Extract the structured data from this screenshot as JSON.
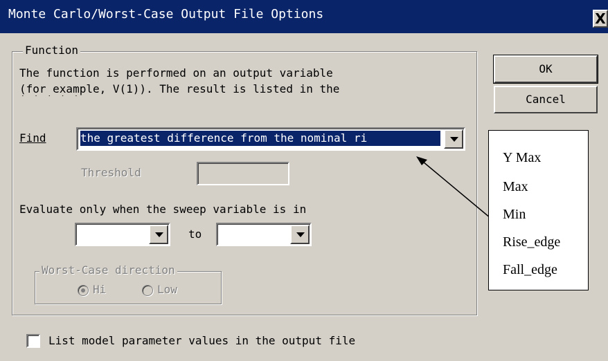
{
  "window": {
    "title": "Monte Carlo/Worst-Case Output File Options",
    "close_glyph": "X"
  },
  "function_group": {
    "legend": "Function",
    "description_line1": "The function is performed on an output variable",
    "description_line2": "(for example,  V(1)).  The result is listed in the",
    "description_line3_partial": "           ' ' ' '   '"
  },
  "find": {
    "label": "Find",
    "value": "the greatest difference from the nominal ri"
  },
  "threshold": {
    "label": "Threshold",
    "value": ""
  },
  "evaluate": {
    "label": "Evaluate only when the sweep variable is in",
    "from_value": "",
    "to_label": "to",
    "to_value": ""
  },
  "worst_case": {
    "legend": "Worst-Case direction",
    "hi_label": "Hi",
    "low_label": "Low",
    "selected": "Hi"
  },
  "buttons": {
    "ok": "OK",
    "cancel": "Cancel"
  },
  "list_params": {
    "label": "List model parameter values in the output file",
    "checked": false
  },
  "callout": {
    "items": [
      "Y Max",
      "Max",
      "Min",
      "Rise_edge",
      "Fall_edge"
    ]
  }
}
